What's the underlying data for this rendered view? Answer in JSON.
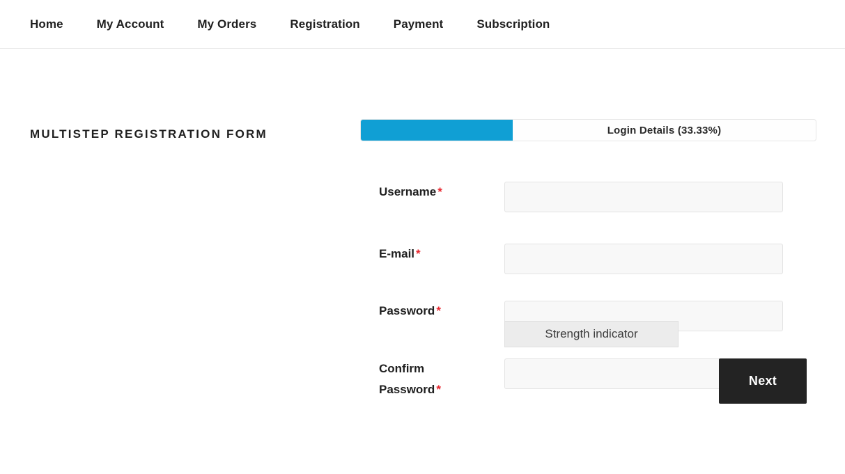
{
  "nav": {
    "items": [
      {
        "label": "Home"
      },
      {
        "label": "My Account"
      },
      {
        "label": "My Orders"
      },
      {
        "label": "Registration"
      },
      {
        "label": "Payment"
      },
      {
        "label": "Subscription"
      }
    ]
  },
  "form": {
    "title": "MULTISTEP REGISTRATION FORM",
    "progress": {
      "label": "Login Details (33.33%)",
      "percent": 33.33,
      "fill_color": "#109fd4",
      "track_color": "#fefefe"
    },
    "fields": [
      {
        "label": "Username",
        "required_mark": "*",
        "value": "",
        "placeholder": ""
      },
      {
        "label": "E-mail",
        "required_mark": "*",
        "value": "",
        "placeholder": ""
      },
      {
        "label": "Password",
        "required_mark": "*",
        "value": "",
        "placeholder": ""
      },
      {
        "label": "Confirm Password",
        "required_mark": "*",
        "value": "",
        "placeholder": ""
      }
    ],
    "strength_indicator": {
      "label": "Strength indicator"
    },
    "next_button": {
      "label": "Next",
      "background": "#232323",
      "text_color": "#ffffff"
    },
    "required_color": "#e8262e"
  }
}
